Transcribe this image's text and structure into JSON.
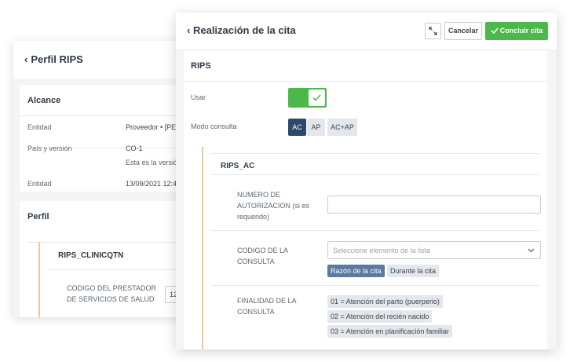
{
  "perfil_window": {
    "title": "Perfil RIPS",
    "alcance": {
      "heading": "Alcance",
      "rows": [
        {
          "key": "Entidad",
          "value": "Proveedor • [PE"
        },
        {
          "key": "País y versión",
          "value": "CO-1",
          "sub": "Esta es la versió"
        },
        {
          "key": "Entidad",
          "value": "13/09/2021 12:4"
        }
      ]
    },
    "perfil": {
      "heading": "Perfil",
      "section": "RIPS_CLINICQTN",
      "field_label": "CODIGO DEL PRESTADOR DE SERVICIOS DE SALUD",
      "field_line1": "CODIGO DEL PRESTADOR",
      "field_line2": "DE SERVICIOS DE SALUD",
      "field_value": "12"
    }
  },
  "cita_window": {
    "title": "Realización de la cita",
    "buttons": {
      "cancel": "Cancelar",
      "finish": "Concluir cita"
    },
    "rips": {
      "heading": "RIPS",
      "usar_label": "Usar",
      "usar_value": true,
      "modo_label": "Modo consulta",
      "modes": [
        "AC",
        "AP",
        "AC+AP"
      ],
      "selected_mode": "AC"
    },
    "rips_ac": {
      "heading": "RIPS_AC",
      "autorizacion": {
        "line1": "NUMERO DE",
        "line2": "AUTORIZACION (si es",
        "line3": "requerido)",
        "value": ""
      },
      "codigo_consulta": {
        "line1": "CODIGO DE LA",
        "line2": "CONSULTA",
        "placeholder": "Seleccione elemento de la lista",
        "options": [
          "Razón de la cita",
          "Durante la cita"
        ],
        "selected": "Razón de la cita"
      },
      "finalidad": {
        "line1": "FINALIDAD DE LA",
        "line2": "CONSULTA",
        "options": [
          "01 = Atención del parto (puerperio)",
          "02 = Atención del recién nacido",
          "03 = Atención en planificación familiar"
        ]
      }
    }
  },
  "colors": {
    "accent_green": "#4cb84a",
    "selected_navy": "#2c4a6b",
    "chip_blue": "#5a7aa0",
    "gold_line": "#e8c99a"
  }
}
